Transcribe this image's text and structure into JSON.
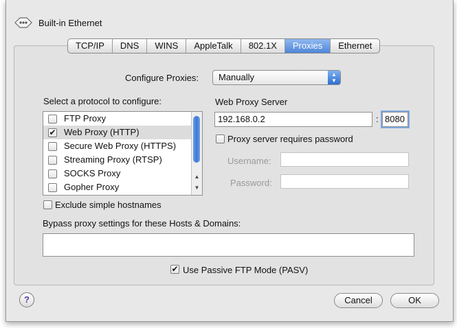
{
  "window": {
    "title": "Built-in Ethernet",
    "icon": "ethernet-icon"
  },
  "tabs": [
    {
      "label": "TCP/IP",
      "active": false
    },
    {
      "label": "DNS",
      "active": false
    },
    {
      "label": "WINS",
      "active": false
    },
    {
      "label": "AppleTalk",
      "active": false
    },
    {
      "label": "802.1X",
      "active": false
    },
    {
      "label": "Proxies",
      "active": true
    },
    {
      "label": "Ethernet",
      "active": false
    }
  ],
  "configure": {
    "label": "Configure Proxies:",
    "value": "Manually"
  },
  "protocols": {
    "label": "Select a protocol to configure:",
    "items": [
      {
        "label": "FTP Proxy",
        "checked": false
      },
      {
        "label": "Web Proxy (HTTP)",
        "checked": true,
        "selected": true
      },
      {
        "label": "Secure Web Proxy (HTTPS)",
        "checked": false
      },
      {
        "label": "Streaming Proxy (RTSP)",
        "checked": false
      },
      {
        "label": "SOCKS Proxy",
        "checked": false
      },
      {
        "label": "Gopher Proxy",
        "checked": false
      }
    ]
  },
  "server": {
    "label": "Web Proxy Server",
    "address": "192.168.0.2",
    "separator": ":",
    "port": "8080",
    "requires_password_label": "Proxy server requires password",
    "username_label": "Username:",
    "password_label": "Password:"
  },
  "exclude": {
    "label": "Exclude simple hostnames",
    "checked": false
  },
  "bypass": {
    "label": "Bypass proxy settings for these Hosts & Domains:",
    "value": ""
  },
  "pasv": {
    "label": "Use Passive FTP Mode (PASV)",
    "checked": true
  },
  "buttons": {
    "help": "?",
    "cancel": "Cancel",
    "ok": "OK"
  },
  "colors": {
    "accent": "#3d78d4",
    "selection": "#dcdcdc"
  }
}
